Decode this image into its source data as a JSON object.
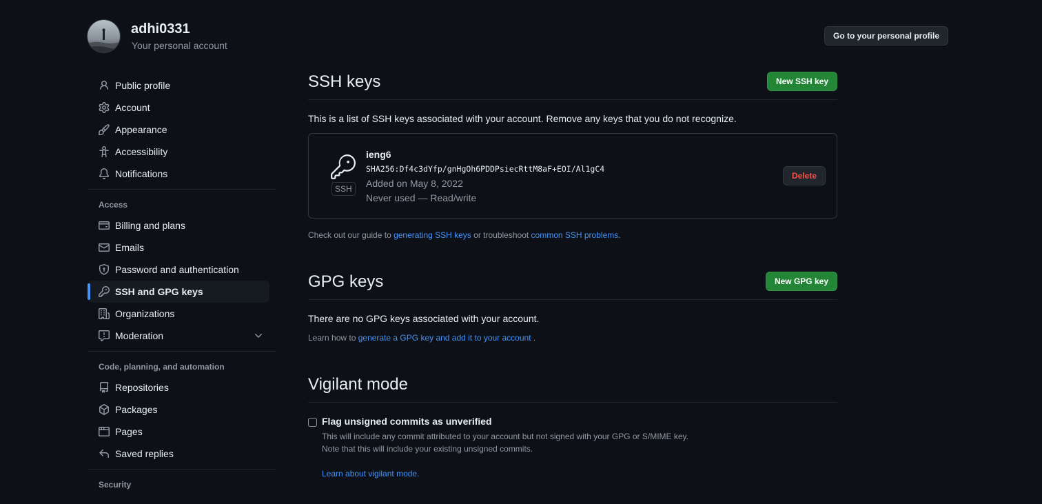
{
  "header": {
    "username": "adhi0331",
    "subtitle": "Your personal account",
    "profile_button": "Go to your personal profile"
  },
  "sidebar": {
    "items_top": [
      {
        "label": "Public profile",
        "icon": "person-icon"
      },
      {
        "label": "Account",
        "icon": "gear-icon"
      },
      {
        "label": "Appearance",
        "icon": "paintbrush-icon"
      },
      {
        "label": "Accessibility",
        "icon": "accessibility-icon"
      },
      {
        "label": "Notifications",
        "icon": "bell-icon"
      }
    ],
    "access_heading": "Access",
    "items_access": [
      {
        "label": "Billing and plans",
        "icon": "credit-card-icon"
      },
      {
        "label": "Emails",
        "icon": "mail-icon"
      },
      {
        "label": "Password and authentication",
        "icon": "shield-lock-icon"
      },
      {
        "label": "SSH and GPG keys",
        "icon": "key-icon",
        "active": true
      },
      {
        "label": "Organizations",
        "icon": "organization-icon"
      },
      {
        "label": "Moderation",
        "icon": "report-icon"
      }
    ],
    "code_heading": "Code, planning, and automation",
    "items_code": [
      {
        "label": "Repositories",
        "icon": "repo-icon"
      },
      {
        "label": "Packages",
        "icon": "package-icon"
      },
      {
        "label": "Pages",
        "icon": "browser-icon"
      },
      {
        "label": "Saved replies",
        "icon": "reply-icon"
      }
    ],
    "security_heading": "Security"
  },
  "ssh": {
    "title": "SSH keys",
    "new_button": "New SSH key",
    "description": "This is a list of SSH keys associated with your account. Remove any keys that you do not recognize.",
    "key": {
      "badge": "SSH",
      "name": "ieng6",
      "fingerprint": "SHA256:Df4c3dYfp/gnHgOh6PDDPsiecRttM8aF+EOI/Al1gC4",
      "added": "Added on May 8, 2022",
      "usage": "Never used — Read/write",
      "delete_button": "Delete"
    },
    "note_prefix": "Check out our guide to ",
    "note_link1": "generating SSH keys",
    "note_middle": " or troubleshoot ",
    "note_link2": "common SSH problems",
    "note_suffix": "."
  },
  "gpg": {
    "title": "GPG keys",
    "new_button": "New GPG key",
    "description": "There are no GPG keys associated with your account.",
    "note_prefix": "Learn how to ",
    "note_link": "generate a GPG key and add it to your account",
    "note_suffix": " ."
  },
  "vigilant": {
    "title": "Vigilant mode",
    "checkbox_label": "Flag unsigned commits as unverified",
    "note1": "This will include any commit attributed to your account but not signed with your GPG or S/MIME key.",
    "note2": "Note that this will include your existing unsigned commits.",
    "link": "Learn about vigilant mode."
  }
}
